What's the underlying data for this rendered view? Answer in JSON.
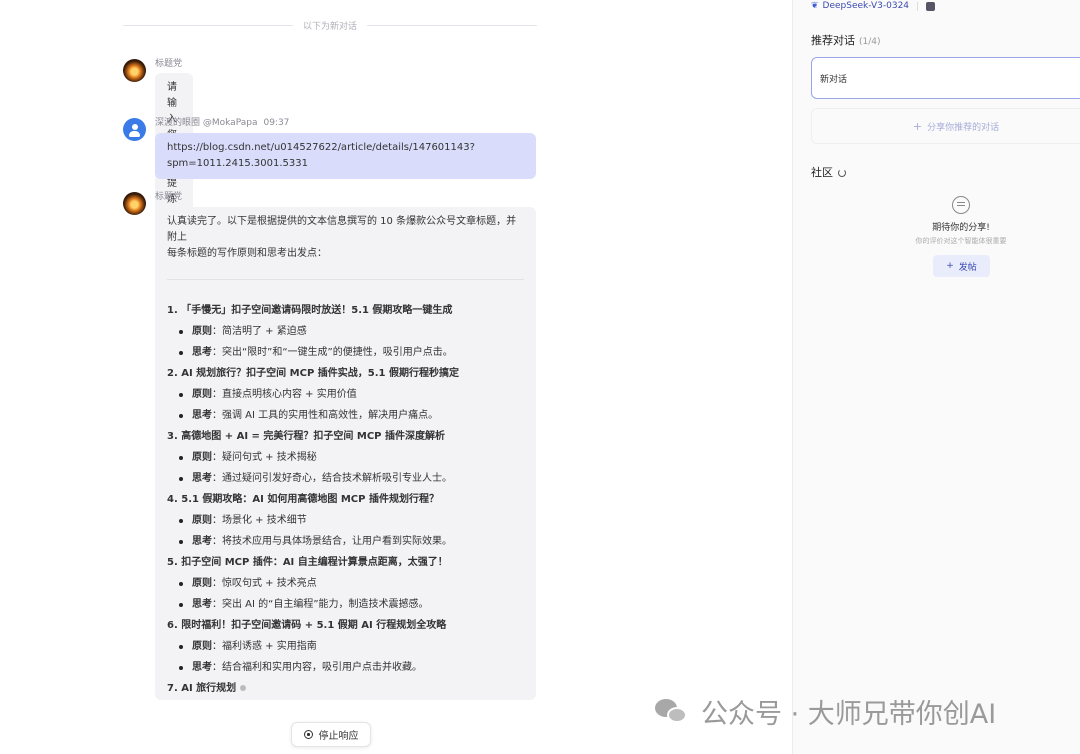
{
  "chat": {
    "divider_text": "以下为新对话",
    "bot_name": "标题党",
    "first_bot_message": "请输入您需要提炼标题的内容!",
    "user_name": "深渡的眼圈 @MokaPapa",
    "user_time": "09:37",
    "user_message_line1": "https://blog.csdn.net/u014527622/article/details/147601143?",
    "user_message_line2": "spm=1011.2415.3001.5331",
    "reply_intro_line1": "认真读完了。以下是根据提供的文本信息撰写的 10 条爆款公众号文章标题，并附上",
    "reply_intro_line2": "每条标题的写作原则和思考出发点：",
    "principle_label": "原则",
    "thinking_label": "思考",
    "items": [
      {
        "title": "1. 「手慢无」扣子空间邀请码限时放送！5.1 假期攻略一键生成",
        "principle": "：简洁明了 + 紧迫感",
        "thinking": "：突出“限时”和“一键生成”的便捷性，吸引用户点击。"
      },
      {
        "title": "2. AI 规划旅行？扣子空间 MCP 插件实战，5.1 假期行程秒搞定",
        "principle": "：直接点明核心内容 + 实用价值",
        "thinking": "：强调 AI 工具的实用性和高效性，解决用户痛点。"
      },
      {
        "title": "3. 高德地图 + AI = 完美行程？扣子空间 MCP 插件深度解析",
        "principle": "：疑问句式 + 技术揭秘",
        "thinking": "：通过疑问引发好奇心，结合技术解析吸引专业人士。"
      },
      {
        "title": "4. 5.1 假期攻略：AI 如何用高德地图 MCP 插件规划行程？",
        "principle": "：场景化 + 技术细节",
        "thinking": "：将技术应用与具体场景结合，让用户看到实际效果。"
      },
      {
        "title": "5. 扣子空间 MCP 插件：AI 自主编程计算景点距离，太强了！",
        "principle": "：惊叹句式 + 技术亮点",
        "thinking": "：突出 AI 的“自主编程”能力，制造技术震撼感。"
      },
      {
        "title": "6. 限时福利！扣子空间邀请码 + 5.1 假期 AI 行程规划全攻略",
        "principle": "：福利诱惑 + 实用指南",
        "thinking": "：结合福利和实用内容，吸引用户点击并收藏。"
      }
    ],
    "last_item_title": "7. AI 旅行规划",
    "stop_button": "停止响应"
  },
  "panel": {
    "model_name": "DeepSeek-V3-0324",
    "recommend_title": "推荐对话",
    "recommend_count": "(1/4)",
    "recommend_item": "新对话",
    "share_button": "分享你推荐的对话",
    "community_title": "社区",
    "empty_title": "期待你的分享!",
    "empty_sub": "你的评价对这个智能体很重要",
    "post_button": "发帖"
  },
  "watermark": "公众号 · 大师兄带你创AI"
}
